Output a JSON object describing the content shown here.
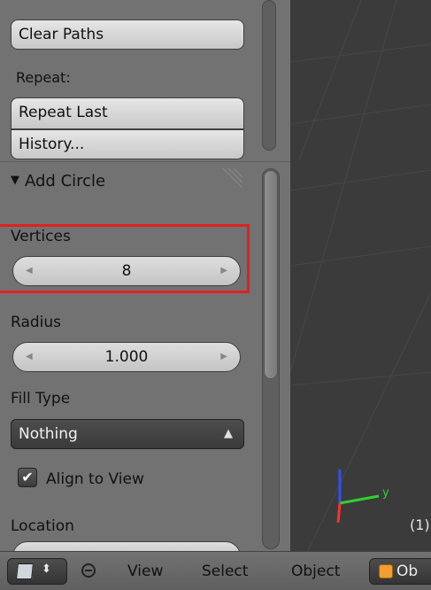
{
  "shelf": {
    "clear_paths": "Clear Paths",
    "repeat_label": "Repeat:",
    "repeat_last": "Repeat Last",
    "history": "History..."
  },
  "operator": {
    "title": "Add Circle",
    "vertices_label": "Vertices",
    "vertices_value": "8",
    "radius_label": "Radius",
    "radius_value": "1.000",
    "fill_type_label": "Fill Type",
    "fill_type_value": "Nothing",
    "align_to_view_label": "Align to View",
    "align_to_view_checked": true,
    "location_label": "Location"
  },
  "viewport": {
    "object_label": "(1)",
    "axis_colors": {
      "x": "#ff3030",
      "y": "#30d030",
      "z": "#3050ff"
    },
    "axis_y_label": "y"
  },
  "header": {
    "menus": [
      "View",
      "Select",
      "Object"
    ],
    "mode_text": "Ob"
  },
  "colors": {
    "highlight": "#e02020",
    "panel_bg": "#727272",
    "viewport_bg": "#3b3b3b"
  }
}
